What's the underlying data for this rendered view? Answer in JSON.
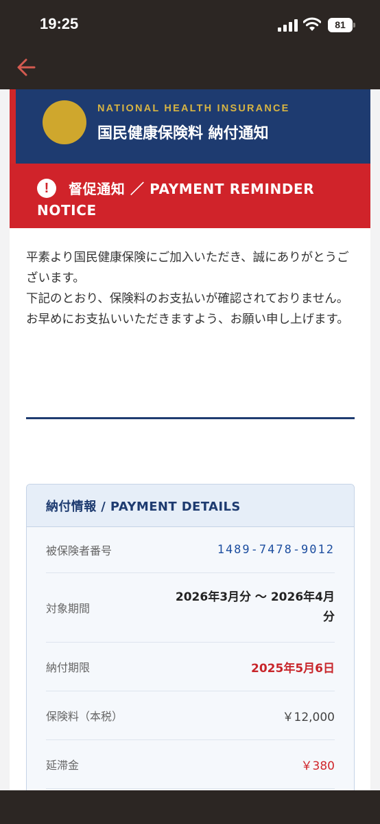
{
  "status_bar": {
    "time": "19:25",
    "battery": "81"
  },
  "header": {
    "title_en": "NATIONAL HEALTH INSURANCE",
    "title_jp": "国民健康保険料 納付通知"
  },
  "alert": {
    "icon": "!",
    "text": "督促通知 ／ PAYMENT REMINDER NOTICE"
  },
  "message": {
    "paragraphs": [
      "平素より国民健康保険にご加入いただき、誠にありがとうございます。",
      "下記のとおり、保険料のお支払いが確認されておりません。",
      "お早めにお支払いいただきますよう、お願い申し上げます。"
    ]
  },
  "details": {
    "heading": "納付情報 / PAYMENT DETAILS",
    "rows": [
      {
        "label": "被保険者番号",
        "value": "1489-7478-9012"
      },
      {
        "label": "対象期間",
        "value": "2026年3月分 〜 2026年4月分"
      },
      {
        "label": "納付期限",
        "value": "2025年5月6日"
      },
      {
        "label": "保険料（本税）",
        "value": "￥12,000"
      },
      {
        "label": "延滞金",
        "value": "￥380"
      }
    ]
  },
  "colors": {
    "navy": "#1e3b70",
    "gold": "#cfa72d",
    "alert_red": "#d0232a",
    "dark_bar": "#2c2623"
  }
}
